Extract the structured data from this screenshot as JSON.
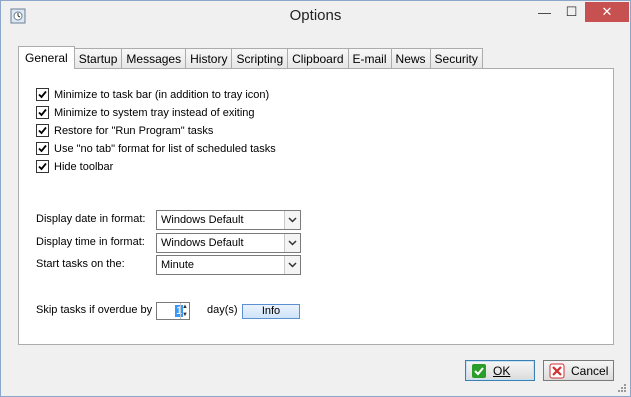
{
  "window": {
    "title": "Options",
    "minimize": "—",
    "maximize": "☐",
    "close": "✕"
  },
  "tabs": [
    "General",
    "Startup",
    "Messages",
    "History",
    "Scripting",
    "Clipboard",
    "E-mail",
    "News",
    "Security"
  ],
  "active_tab": "General",
  "checkboxes": [
    {
      "label": "Minimize to task bar (in addition to tray icon)",
      "checked": true
    },
    {
      "label": "Minimize to system tray instead of exiting",
      "checked": true
    },
    {
      "label": "Restore for \"Run Program\" tasks",
      "checked": true
    },
    {
      "label": "Use \"no tab\" format for list of scheduled tasks",
      "checked": true
    },
    {
      "label": "Hide toolbar",
      "checked": true
    }
  ],
  "date_format": {
    "label": "Display date in format:",
    "value": "Windows Default"
  },
  "time_format": {
    "label": "Display time in format:",
    "value": "Windows Default"
  },
  "start_tasks": {
    "label": "Start tasks on the:",
    "value": "Minute"
  },
  "skip": {
    "label": "Skip tasks if overdue by",
    "value": "1",
    "unit": "day(s)",
    "info_label": "Info"
  },
  "buttons": {
    "ok": "OK",
    "cancel": "Cancel"
  },
  "colors": {
    "accent": "#3399ff",
    "close": "#c75050",
    "check_green": "#2a9d2a",
    "cancel_red": "#d03030"
  }
}
